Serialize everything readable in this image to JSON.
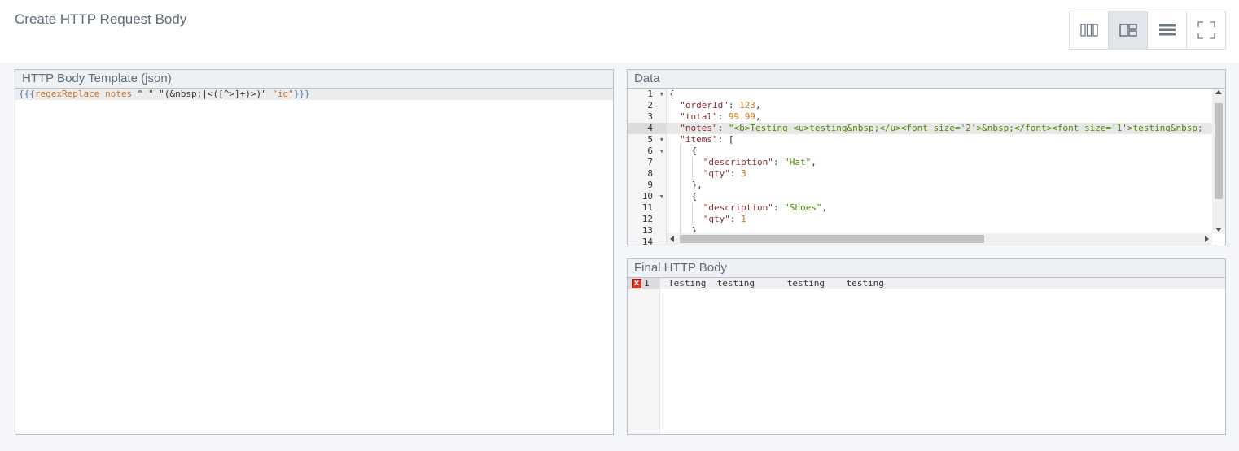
{
  "page": {
    "title": "Create HTTP Request Body"
  },
  "layout_toolbar": {
    "buttons": [
      {
        "name": "three-columns",
        "icon": "columns-icon",
        "active": false
      },
      {
        "name": "split",
        "icon": "split-layout-icon",
        "active": true
      },
      {
        "name": "rows",
        "icon": "rows-icon",
        "active": false
      },
      {
        "name": "fullscreen",
        "icon": "fullscreen-icon",
        "active": false
      }
    ]
  },
  "template_panel": {
    "title": "HTTP Body Template (json)",
    "tokens": {
      "open": "{{{",
      "helper": "regexReplace",
      "arg": "notes",
      "s1": "\" \"",
      "s2": "\"(&nbsp;|<([^>]+)>)\"",
      "s3": "\"ig\"",
      "close": "}}}"
    }
  },
  "data_panel": {
    "title": "Data",
    "line_numbers": [
      "1",
      "2",
      "3",
      "4",
      "5",
      "6",
      "7",
      "8",
      "9",
      "10",
      "11",
      "12",
      "13",
      "14"
    ],
    "lines": {
      "l1": "{",
      "l2_key": "\"orderId\"",
      "l2_val": "123",
      "l3_key": "\"total\"",
      "l3_val": "99.99",
      "l4_key": "\"notes\"",
      "l4_val": "\"<b>Testing <u>testing&nbsp;</u><font size='2'>&nbsp;</font><font size='1'>testing&nbsp;",
      "l5_key": "\"items\"",
      "l5_val": "[",
      "l6": "{",
      "l7_key": "\"description\"",
      "l7_val": "\"Hat\"",
      "l8_key": "\"qty\"",
      "l8_val": "3",
      "l9": "},",
      "l10": "{",
      "l11_key": "\"description\"",
      "l11_val": "\"Shoes\"",
      "l12_key": "\"qty\"",
      "l12_val": "1",
      "l13": "}"
    }
  },
  "final_panel": {
    "title": "Final HTTP Body",
    "line_number": "1",
    "output": "Testing  testing      testing    testing",
    "error_icon": "x"
  }
}
